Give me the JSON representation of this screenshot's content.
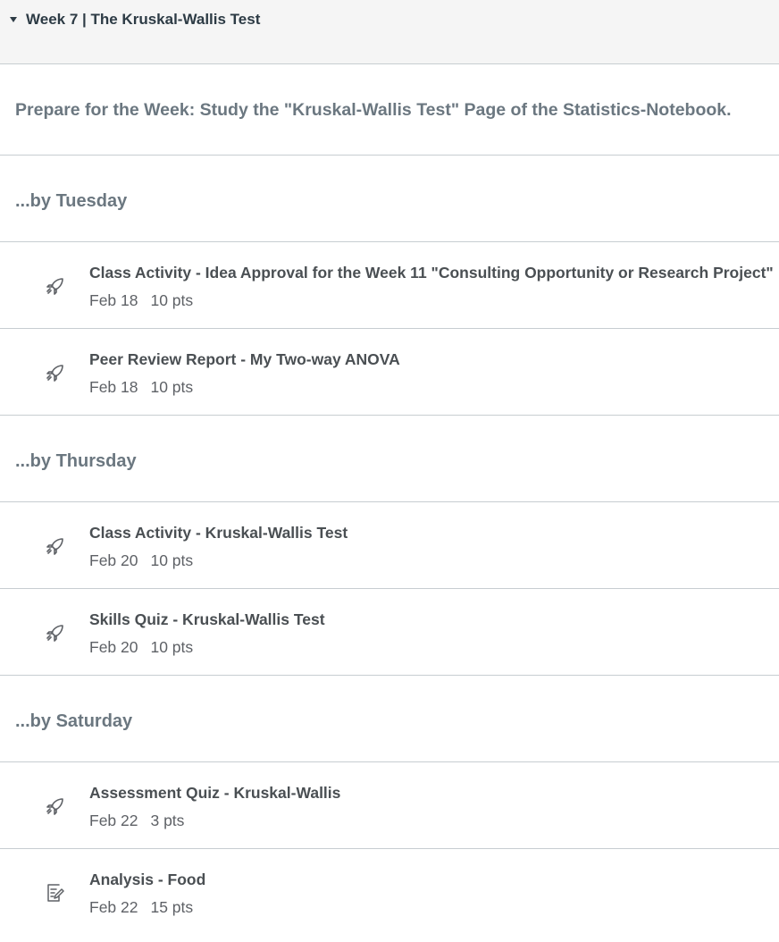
{
  "module": {
    "title": "Week 7 | The Kruskal-Wallis Test"
  },
  "prepare": {
    "text": "Prepare for the Week: Study the \"Kruskal-Wallis Test\" Page of the Statistics-Notebook."
  },
  "sections": [
    {
      "header": "...by Tuesday",
      "items": [
        {
          "title": "Class Activity - Idea Approval for the Week 11 \"Consulting Opportunity or Research Project\"",
          "date": "Feb 18",
          "points": "10 pts",
          "icon": "rocket-icon"
        },
        {
          "title": "Peer Review Report - My Two-way ANOVA",
          "date": "Feb 18",
          "points": "10 pts",
          "icon": "rocket-icon"
        }
      ]
    },
    {
      "header": "...by Thursday",
      "items": [
        {
          "title": "Class Activity - Kruskal-Wallis Test",
          "date": "Feb 20",
          "points": "10 pts",
          "icon": "rocket-icon"
        },
        {
          "title": "Skills Quiz - Kruskal-Wallis Test",
          "date": "Feb 20",
          "points": "10 pts",
          "icon": "rocket-icon"
        }
      ]
    },
    {
      "header": "...by Saturday",
      "items": [
        {
          "title": "Assessment Quiz - Kruskal-Wallis",
          "date": "Feb 22",
          "points": "3 pts",
          "icon": "rocket-icon"
        },
        {
          "title": "Analysis - Food",
          "date": "Feb 22",
          "points": "15 pts",
          "icon": "assignment-edit-icon"
        }
      ]
    }
  ]
}
